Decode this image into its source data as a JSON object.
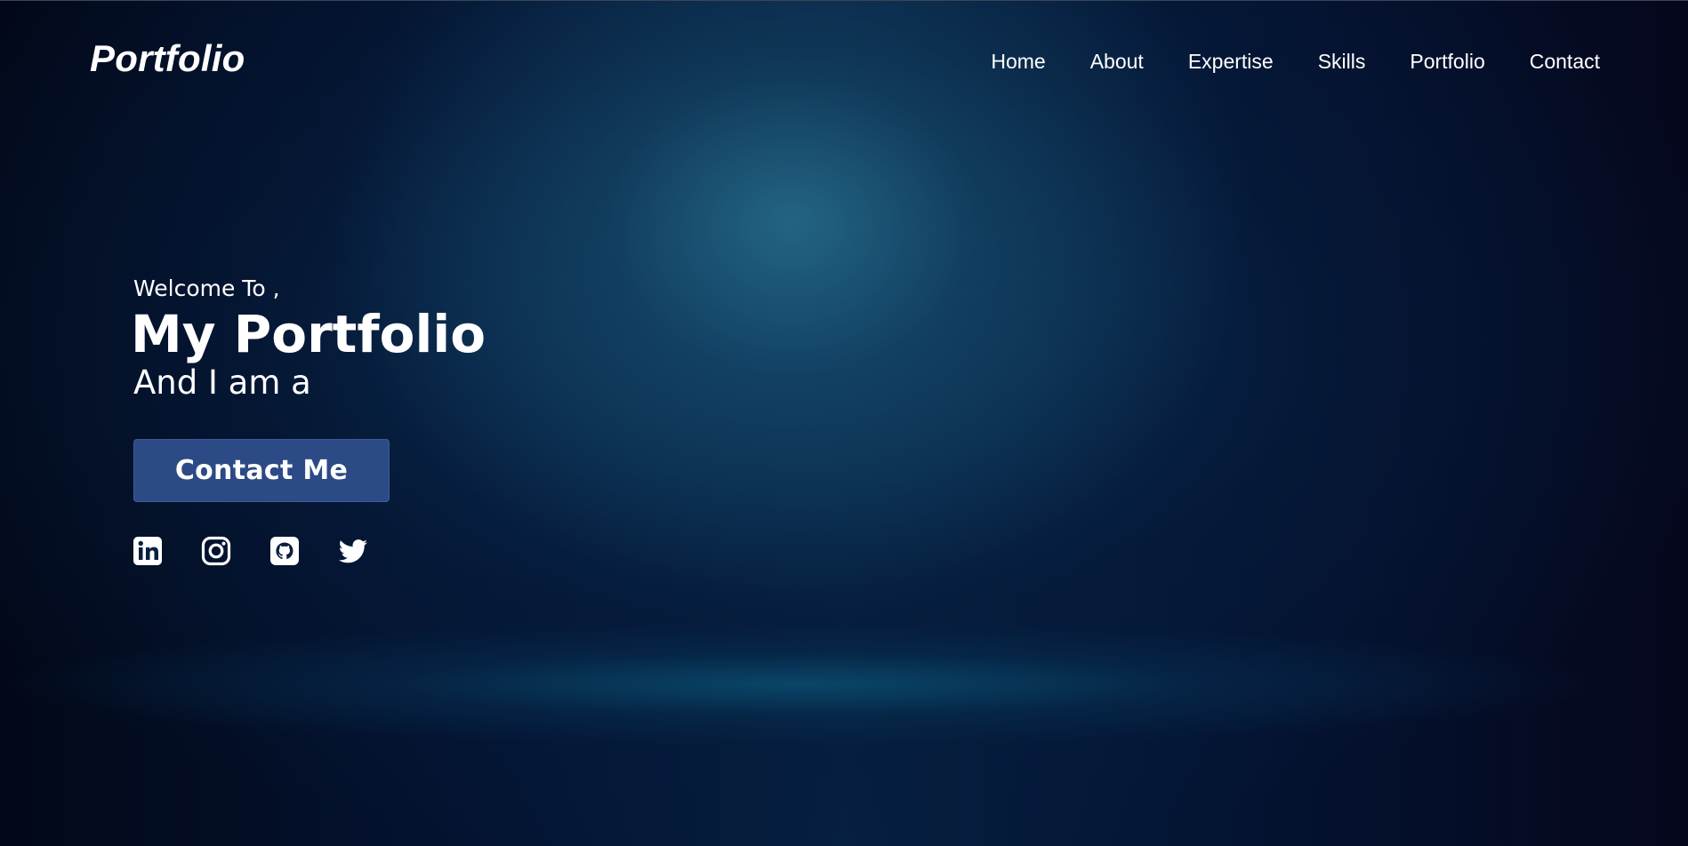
{
  "navbar": {
    "logo": "Portfolio",
    "links": [
      "Home",
      "About",
      "Expertise",
      "Skills",
      "Portfolio",
      "Contact"
    ]
  },
  "hero": {
    "welcome": "Welcome To ,",
    "title": "My Portfolio",
    "subtitle": "And I am a",
    "cta_label": "Contact Me"
  },
  "socials": [
    {
      "icon": "linkedin-icon"
    },
    {
      "icon": "instagram-icon"
    },
    {
      "icon": "github-icon"
    },
    {
      "icon": "twitter-icon"
    }
  ],
  "colors": {
    "background": "#030a1e",
    "accent_glow": "#1f5f80",
    "button": "#2c4a85",
    "text": "#ffffff"
  }
}
